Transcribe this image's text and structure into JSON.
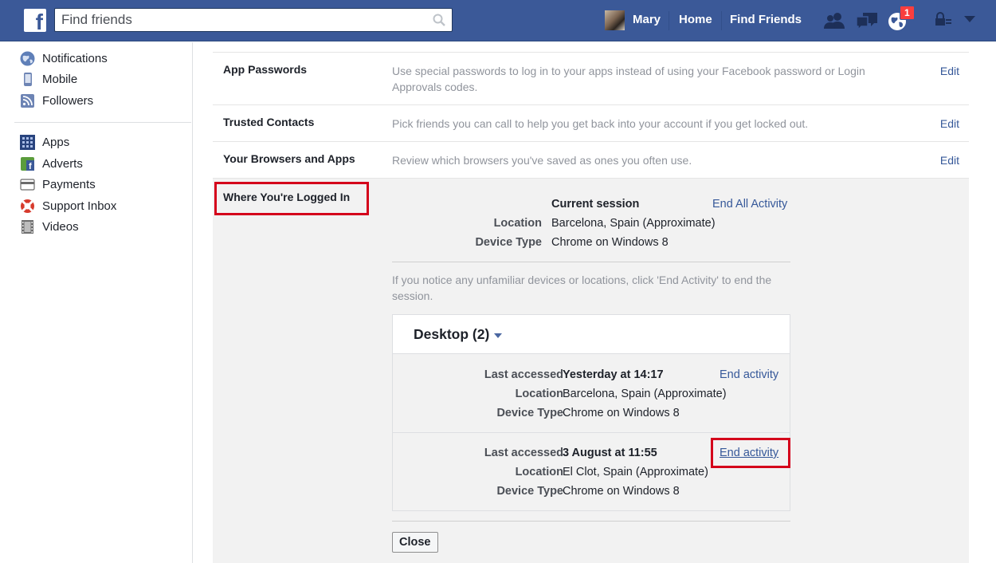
{
  "topbar": {
    "search_placeholder": "Find friends",
    "user_name": "Mary",
    "home": "Home",
    "find_friends": "Find Friends",
    "notification_count": "1"
  },
  "sidebar": {
    "items_top": [
      {
        "label": "Notifications",
        "icon": "globe-icon"
      },
      {
        "label": "Mobile",
        "icon": "mobile-phone-icon"
      },
      {
        "label": "Followers",
        "icon": "rss-icon"
      }
    ],
    "items_bottom": [
      {
        "label": "Apps",
        "icon": "apps-icon"
      },
      {
        "label": "Adverts",
        "icon": "adverts-icon"
      },
      {
        "label": "Payments",
        "icon": "credit-card-icon"
      },
      {
        "label": "Support Inbox",
        "icon": "lifebuoy-icon"
      },
      {
        "label": "Videos",
        "icon": "film-icon"
      }
    ]
  },
  "settings": {
    "rows": [
      {
        "title": "App Passwords",
        "desc": "Use special passwords to log in to your apps instead of using your Facebook password or Login Approvals codes.",
        "edit": "Edit"
      },
      {
        "title": "Trusted Contacts",
        "desc": "Pick friends you can call to help you get back into your account if you get locked out.",
        "edit": "Edit"
      },
      {
        "title": "Your Browsers and Apps",
        "desc": "Review which browsers you've saved as ones you often use.",
        "edit": "Edit"
      }
    ],
    "logged_in": {
      "title": "Where You're Logged In",
      "current": {
        "heading": "Current session",
        "end_all": "End All Activity",
        "location_label": "Location",
        "location": "Barcelona, Spain (Approximate)",
        "device_label": "Device Type",
        "device": "Chrome on Windows 8"
      },
      "notice": "If you notice any unfamiliar devices or locations, click 'End Activity' to end the session.",
      "group": {
        "title": "Desktop (2)",
        "sessions": [
          {
            "accessed_label": "Last accessed",
            "accessed": "Yesterday at 14:17",
            "end": "End activity",
            "location_label": "Location",
            "location": "Barcelona, Spain (Approximate)",
            "device_label": "Device Type",
            "device": "Chrome on Windows 8"
          },
          {
            "accessed_label": "Last accessed",
            "accessed": "3 August at 11:55",
            "end": "End activity",
            "location_label": "Location",
            "location": "El Clot, Spain (Approximate)",
            "device_label": "Device Type",
            "device": "Chrome on Windows 8"
          }
        ]
      },
      "close": "Close"
    }
  },
  "colors": {
    "brand": "#3b5998",
    "link": "#365899",
    "highlight": "#d4001b"
  }
}
